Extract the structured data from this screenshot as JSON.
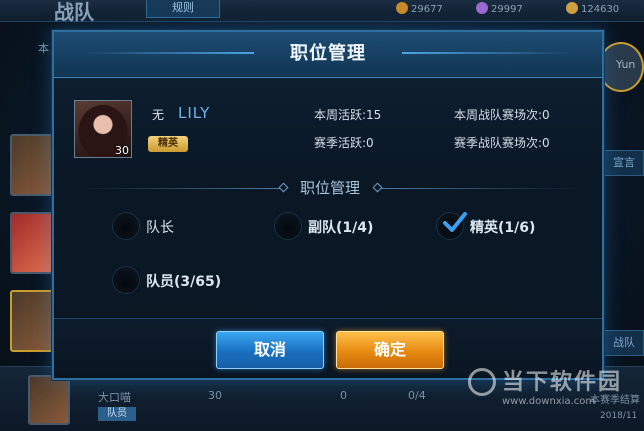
{
  "background": {
    "title": "战队",
    "rules_tab": "规则",
    "resources": [
      "29677",
      "29997",
      "124630"
    ],
    "left_tab": "本",
    "right_name": "Yun",
    "right_buttons": [
      "宣言",
      "战队"
    ],
    "row": {
      "name": "大口喵",
      "level": "30",
      "rank_badge": "队员",
      "active": "0",
      "battles": "0/4",
      "note": "本赛季结算",
      "date": "2018/11"
    }
  },
  "watermark": {
    "text": "当下软件园",
    "url": "www.downxia.com"
  },
  "modal": {
    "title": "职位管理",
    "player": {
      "rank_prefix": "无",
      "name": "LILY",
      "level": "30",
      "role": "精英",
      "stats": {
        "weekly_active": "本周活跃:15",
        "weekly_battles": "本周战队赛场次:0",
        "season_active": "赛季活跃:0",
        "season_battles": "赛季战队赛场次:0"
      }
    },
    "section_title": "职位管理",
    "options": [
      {
        "label": "队长",
        "selected": false
      },
      {
        "label": "副队(1/4)",
        "selected": false
      },
      {
        "label": "精英(1/6)",
        "selected": true
      },
      {
        "label": "队员(3/65)",
        "selected": false
      }
    ],
    "buttons": {
      "cancel": "取消",
      "confirm": "确定"
    },
    "colors": {
      "accent_blue": "#2f6f9f",
      "cancel_blue": "#1a6fc0",
      "confirm_orange": "#e78a12",
      "check_blue": "#3aa0f0"
    }
  }
}
